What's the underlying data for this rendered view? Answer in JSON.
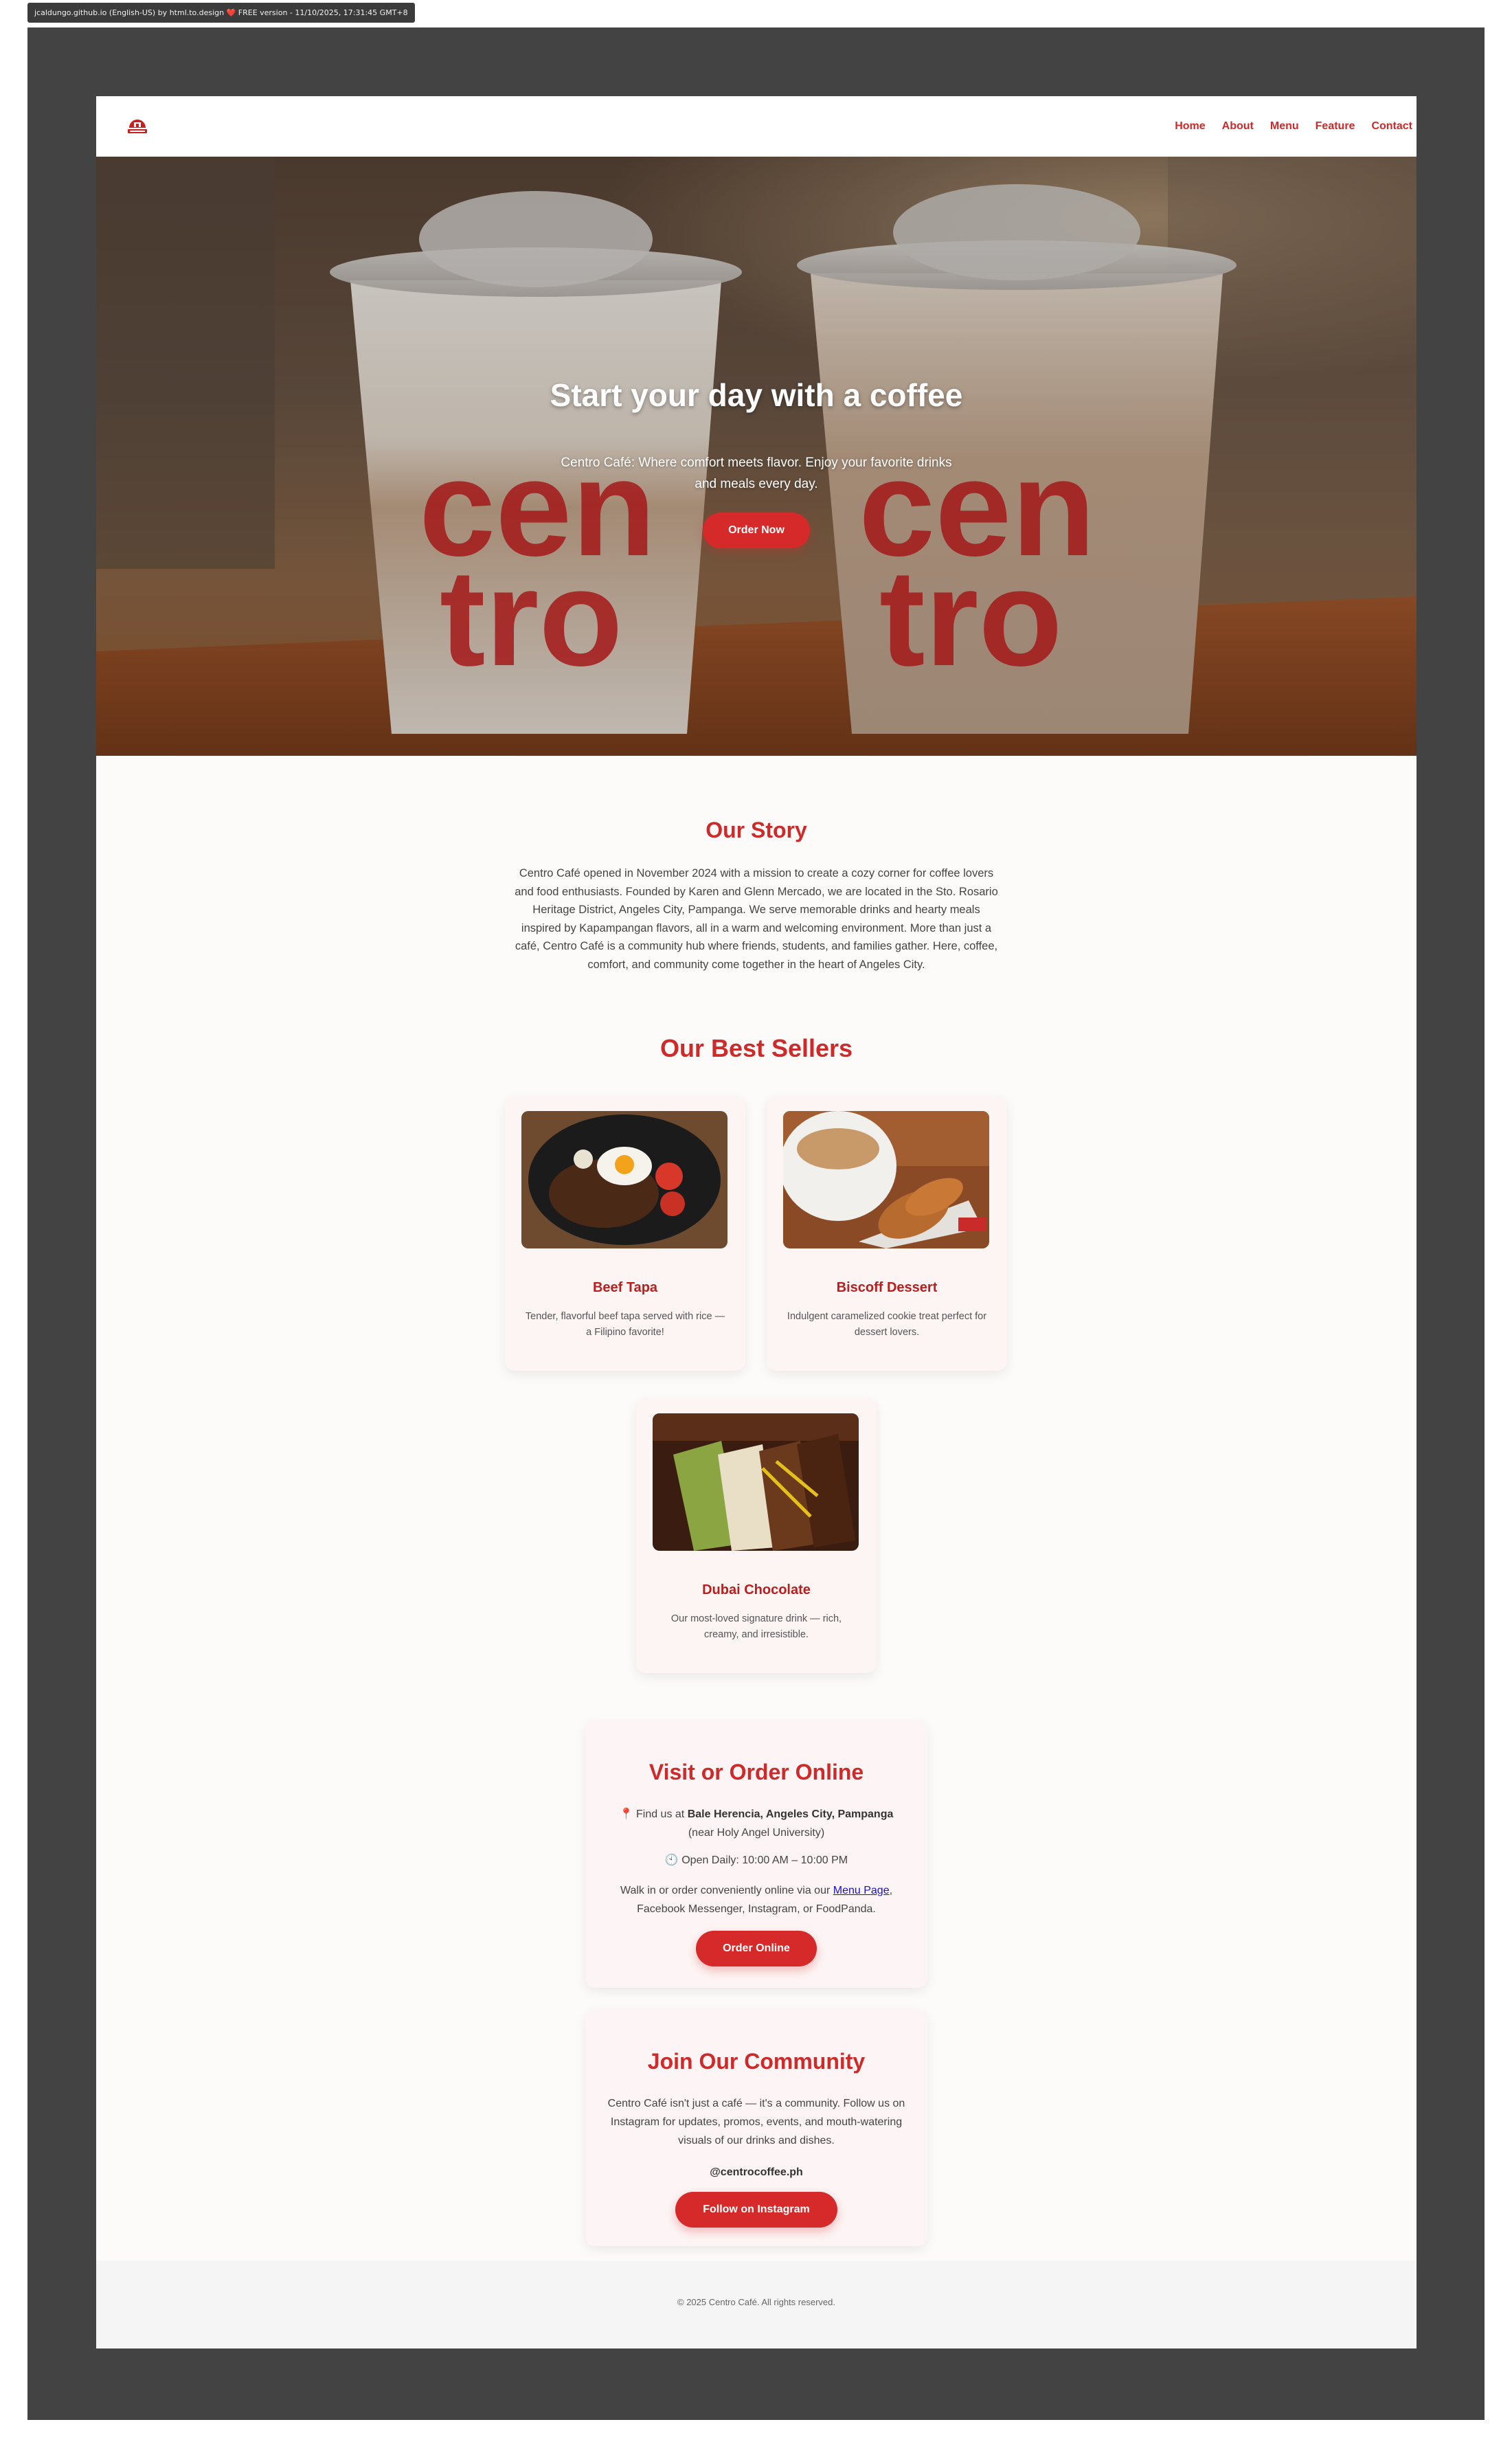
{
  "capture_tag": "jcaldungo.github.io (English-US) by html.to.design ❤️ FREE version - 11/10/2025, 17:31:45 GMT+8",
  "nav": {
    "logo_icon": "centro-logo-icon",
    "links": [
      "Home",
      "About",
      "Menu",
      "Feature",
      "Contact"
    ]
  },
  "hero": {
    "title": "Start your day with a coffee",
    "subtitle": "Centro Café: Where comfort meets flavor. Enjoy your favorite drinks and meals every day.",
    "button": "Order Now",
    "cup_print": [
      "cen",
      "tro"
    ]
  },
  "story": {
    "title": "Our Story",
    "text": "Centro Café opened in November 2024 with a mission to create a cozy corner for coffee lovers and food enthusiasts. Founded by Karen and Glenn Mercado, we are located in the Sto. Rosario Heritage District, Angeles City, Pampanga. We serve memorable drinks and hearty meals inspired by Kapampangan flavors, all in a warm and welcoming environment. More than just a café, Centro Café is a community hub where friends, students, and families gather. Here, coffee, comfort, and community come together in the heart of Angeles City."
  },
  "sellers": {
    "title": "Our Best Sellers",
    "items": [
      {
        "name": "Beef Tapa",
        "desc": "Tender, flavorful beef tapa served with rice — a Filipino favorite!"
      },
      {
        "name": "Biscoff Dessert",
        "desc": "Indulgent caramelized cookie treat perfect for dessert lovers."
      },
      {
        "name": "Dubai Chocolate",
        "desc": "Our most-loved signature drink — rich, creamy, and irresistible."
      }
    ]
  },
  "visit": {
    "title": "Visit or Order Online",
    "find_prefix": "Find us at",
    "find_place": "Bale Herencia, Angeles City, Pampanga",
    "find_near": "(near Holy Angel University)",
    "hours": "Open Daily: 10:00 AM – 10:00 PM",
    "walk_prefix": "Walk in or order conveniently online via our",
    "walk_link": "Menu Page",
    "walk_suffix": ", Facebook Messenger, Instagram, or FoodPanda.",
    "button": "Order Online"
  },
  "community": {
    "title": "Join Our Community",
    "text": "Centro Café isn't just a café — it's a community. Follow us on Instagram for updates, promos, events, and mouth-watering visuals of our drinks and dishes.",
    "handle": "@centrocoffee.ph",
    "button": "Follow on Instagram"
  },
  "footer": {
    "text": "© 2025 Centro Café. All rights reserved."
  },
  "colors": {
    "brand_red": "#cf2a2a",
    "button_red": "#d62a2a",
    "frame_gray": "#434343"
  }
}
